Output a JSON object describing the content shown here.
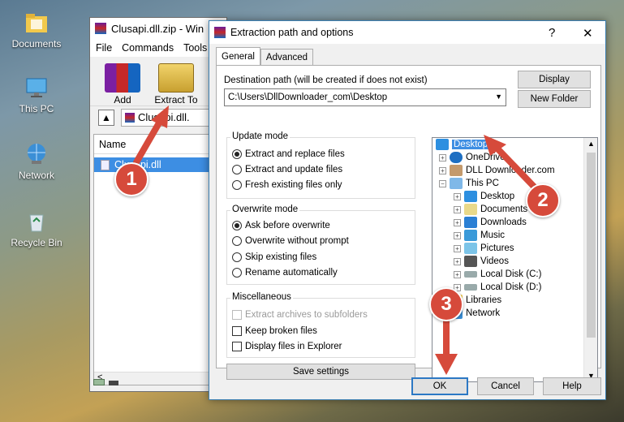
{
  "desktop": {
    "icons": [
      {
        "label": "Documents",
        "icon": "folder-icon"
      },
      {
        "label": "This PC",
        "icon": "computer-icon"
      },
      {
        "label": "Network",
        "icon": "network-icon"
      },
      {
        "label": "Recycle Bin",
        "icon": "recycle-bin-icon"
      }
    ]
  },
  "winrar": {
    "title": "Clusapi.dll.zip - Win",
    "menu": [
      "File",
      "Commands",
      "Tools"
    ],
    "toolbar": [
      {
        "label": "Add",
        "icon": "add-archive-icon"
      },
      {
        "label": "Extract To",
        "icon": "extract-to-icon"
      }
    ],
    "path": "Clusapi.dll.",
    "column_name": "Name",
    "file": "Clusapi.dll",
    "scroll_left": "<"
  },
  "dialog": {
    "title": "Extraction path and options",
    "help": "?",
    "close": "✕",
    "tabs": [
      "General",
      "Advanced"
    ],
    "dest_label": "Destination path (will be created if does not exist)",
    "dest_value": "C:\\Users\\DllDownloader_com\\Desktop",
    "btn_display": "Display",
    "btn_new_folder": "New Folder",
    "update_mode": {
      "title": "Update mode",
      "options": [
        "Extract and replace files",
        "Extract and update files",
        "Fresh existing files only"
      ],
      "selected": 0
    },
    "overwrite_mode": {
      "title": "Overwrite mode",
      "options": [
        "Ask before overwrite",
        "Overwrite without prompt",
        "Skip existing files",
        "Rename automatically"
      ],
      "selected": 0
    },
    "misc": {
      "title": "Miscellaneous",
      "options": [
        "Extract archives to subfolders",
        "Keep broken files",
        "Display files in Explorer"
      ]
    },
    "btn_save": "Save settings",
    "tree": [
      {
        "label": "Desktop",
        "level": 0,
        "selected": true
      },
      {
        "label": "OneDrive",
        "level": 1
      },
      {
        "label": "DLL Downloader.com",
        "level": 1
      },
      {
        "label": "This PC",
        "level": 1
      },
      {
        "label": "Desktop",
        "level": 2
      },
      {
        "label": "Documents",
        "level": 2
      },
      {
        "label": "Downloads",
        "level": 2
      },
      {
        "label": "Music",
        "level": 2
      },
      {
        "label": "Pictures",
        "level": 2
      },
      {
        "label": "Videos",
        "level": 2
      },
      {
        "label": "Local Disk (C:)",
        "level": 2
      },
      {
        "label": "Local Disk (D:)",
        "level": 2
      },
      {
        "label": "Libraries",
        "level": 1
      },
      {
        "label": "Network",
        "level": 1
      }
    ],
    "btn_ok": "OK",
    "btn_cancel": "Cancel",
    "btn_help": "Help"
  },
  "annotations": [
    "1",
    "2",
    "3"
  ],
  "colors": {
    "annotation": "#d64a3b",
    "selection": "#3d8ee3"
  }
}
